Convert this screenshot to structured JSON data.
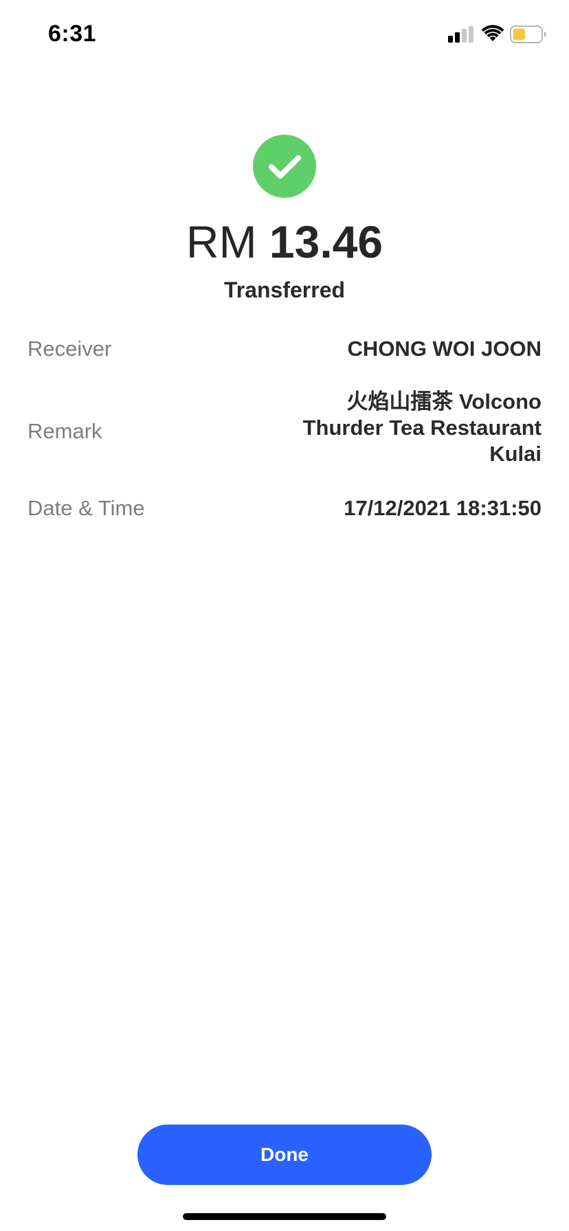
{
  "status_bar": {
    "time": "6:31",
    "signal_icon": "cellular-signal-icon",
    "wifi_icon": "wifi-icon",
    "battery_icon": "battery-icon",
    "battery_level": 0.45,
    "battery_color": "#f5c842"
  },
  "success": {
    "icon": "checkmark-circle-icon",
    "icon_color": "#5fcf6a",
    "currency": "RM",
    "amount": "13.46",
    "status": "Transferred"
  },
  "details": {
    "receiver_label": "Receiver",
    "receiver_value": "CHONG WOI JOON",
    "remark_label": "Remark",
    "remark_line1": "火焰山擂茶 Volcono",
    "remark_line2": "Thurder Tea Restaurant",
    "remark_line3": "Kulai",
    "datetime_label": "Date & Time",
    "datetime_value": "17/12/2021 18:31:50"
  },
  "actions": {
    "done_label": "Done",
    "button_color": "#2962ff"
  }
}
